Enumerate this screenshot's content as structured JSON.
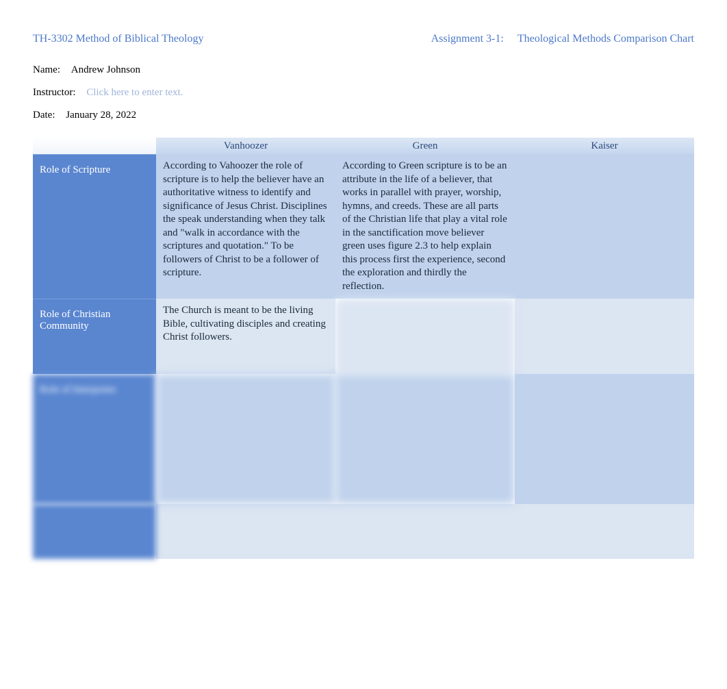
{
  "header": {
    "course": "TH-3302  Method of Biblical Theology",
    "assignment_label": "Assignment 3-1:",
    "assignment_title": "Theological Methods Comparison Chart"
  },
  "meta": {
    "name_label": "Name:",
    "name_value": "Andrew Johnson",
    "instructor_label": "Instructor:",
    "instructor_placeholder": "Click here to enter text.",
    "date_label": "Date:",
    "date_value": "January 28, 2022"
  },
  "table": {
    "columns": [
      "Vanhoozer",
      "Green",
      "Kaiser"
    ],
    "rows": [
      {
        "label": "Role of Scripture",
        "cells": [
          "According to Vahoozer the role of scripture is to help the believer have an authoritative witness to identify and significance of Jesus Christ. Disciplines the speak understanding when they talk and \"walk in accordance with the scriptures and quotation.\" To be followers of Christ to be a follower of scripture.",
          "According to Green scripture is to be an attribute in the life of a believer, that works in parallel with prayer, worship, hymns, and creeds. These are all parts of the Christian life that play a vital role in the sanctification move believer green uses figure 2.3 to help explain this process first the experience, second the exploration and thirdly the reflection.",
          ""
        ]
      },
      {
        "label": "Role of Christian Community",
        "cells": [
          "The Church is meant to be the living Bible, cultivating disciples and creating Christ followers.",
          "",
          ""
        ]
      },
      {
        "label": "Role of Interpreter",
        "cells": [
          "",
          "",
          ""
        ]
      },
      {
        "label": "",
        "cells": [
          "",
          "",
          ""
        ]
      }
    ]
  }
}
